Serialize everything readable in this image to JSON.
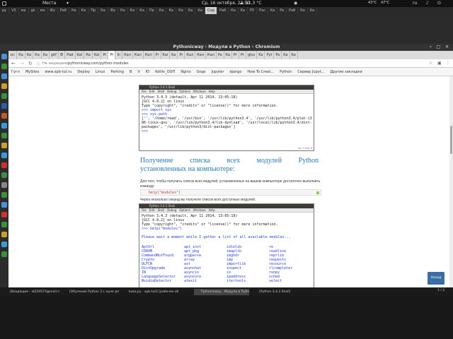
{
  "topbar": {
    "menu": "Места",
    "datetime": "Ср, 16 октября, 23:50",
    "weather": "11,3 °C",
    "stat1": "43°C",
    "stat2": "47°C",
    "language": "ru"
  },
  "desktop_tabs": [
    "ру",
    "VS",
    "ма",
    "gk",
    "ма",
    "Фу",
    "Раб",
    "Ка",
    "Ка",
    "Пр",
    "Ка",
    "Фу",
    "Ка",
    "Ка",
    "Ка",
    "Пр",
    "Ка",
    "Ка",
    "Ка",
    "Ка",
    "Ка",
    "Сод",
    "Раб",
    "Ка",
    "Ka",
    "РУ",
    "Рас",
    "Ka",
    "Pa",
    "Раб",
    "Ка",
    "Ka"
  ],
  "window": {
    "title": "Pythonicway - Модули в Python – Chromium"
  },
  "browser": {
    "tabs": [
      "vs:",
      "Ка",
      "Ka",
      "Ка",
      "Ka",
      "gkf",
      "Ф",
      "Рай",
      "Kal",
      "Ка",
      "Kal",
      "Pr",
      "Pr",
      "In",
      "Кал",
      "Кал",
      "Кал",
      "Pr",
      "Kal",
      "Ka",
      "Pr",
      "Кал",
      "Кал",
      "Кал",
      "Pa",
      "Ka",
      "Pr",
      "Pr",
      "glos",
      "Ka",
      "Pyt",
      "Pa",
      "Ka",
      "Ka"
    ],
    "address": {
      "security": "Не защищено",
      "url": "pythonicway.com/python-modules"
    },
    "bookmarks": [
      "Гугл",
      "MySites",
      "www.spb-tut.ru",
      "Deploy",
      "Linux",
      "Parking",
      "B",
      "V",
      "Ю",
      "Kotlin_OOП",
      "Nginx",
      "Gogs",
      "Jupyter",
      "django",
      "How To Creat...",
      "Python",
      "Сервер Jupyt...",
      "Другие закладки"
    ]
  },
  "terminal1": {
    "title": "Python 3.4.3 Shell",
    "menu": [
      "File",
      "Edit",
      "Shell",
      "Debug",
      "Options",
      "Windows",
      "Help"
    ],
    "lines": [
      {
        "t": "Python 3.4.3 (default, Apr 11 2014, 13:05:18)",
        "c": ""
      },
      {
        "t": "[GCC 4.8.2] on linux",
        "c": ""
      },
      {
        "t": "Type \"copyright\", \"credits\" or \"license()\" for more information.",
        "c": ""
      },
      {
        "t": ">>> import sys",
        "c": "blue"
      },
      {
        "t": ">>> sys.path",
        "c": "blue"
      },
      {
        "t": "['', '/home/read', '/usr/bin', '/usr/lib/python3.4', '/usr/lib/python3.4/plat-i3",
        "c": ""
      },
      {
        "t": "86-linux-gnu', '/usr/lib/python3.4/lib-dynload', '/usr/local/lib/python3.4/dist-",
        "c": ""
      },
      {
        "t": "packages', '/usr/lib/python3/dist-packages']",
        "c": ""
      },
      {
        "t": ">>>",
        "c": "blue"
      }
    ],
    "status": "Ln: 7 Col: 4"
  },
  "section": {
    "heading_line1": "Получение списка всех модулей Python",
    "heading_line2": "установленных на компьютере:",
    "paragraph1": "Для того, чтобы получить список всех модулей, установленных на вашем компьютере достаточно выполнить команду:",
    "code": "help(\"modules\")",
    "paragraph2": "Через несколько секунд вы получите список всех доступных модулей."
  },
  "terminal2": {
    "title": "Python 3.4.3 Shell",
    "menu": [
      "File",
      "Edit",
      "Shell",
      "Debug",
      "Options",
      "Windows",
      "Help"
    ],
    "header_lines": [
      {
        "t": "Python 3.4.3 (default, Apr 11 2014, 13:05:18)",
        "c": ""
      },
      {
        "t": "[GCC 4.8.2] on linux",
        "c": ""
      },
      {
        "t": "Type \"copyright\", \"credits\" or \"license()\" for more information.",
        "c": ""
      },
      {
        "t": ">>> help(\"modules\")",
        "c": "blue"
      },
      {
        "t": "",
        "c": ""
      },
      {
        "t": "Please wait a moment while I gather a list of all available modules...",
        "c": "blue"
      },
      {
        "t": "",
        "c": ""
      }
    ],
    "modules": [
      [
        "AptUrl",
        "apt_inst",
        "idlelib",
        "re"
      ],
      [
        "CDROM",
        "apt_pkg",
        "imaplib",
        "readline"
      ],
      [
        "CommandNotFound",
        "argparse",
        "imghdr",
        "reprlib"
      ],
      [
        "Crypto",
        "array",
        "imp",
        "requests"
      ],
      [
        "DLFCN",
        "ast",
        "importlib",
        "resource"
      ],
      [
        "DistUpgrade",
        "asynchat",
        "inspect",
        "rlcompleter"
      ],
      [
        "IN",
        "asyncio",
        "io",
        "runpy"
      ],
      [
        "LanguageSelector",
        "asyncore",
        "ipaddress",
        "sched"
      ],
      [
        "NvidiaDetector",
        "atexit",
        "itertools",
        "select"
      ]
    ]
  },
  "next_button": "Назад",
  "page_indicator": "1 / 2",
  "taskbar": [
    "[Входящие - id250573@mail.ru]",
    "[Обучение Python 3 с нуля для пр...",
    "kuka.py - spb-tut2 [рабочее области...",
    "Pythonicway - Модули в Python –...",
    "[Python 3.4.3 Shell]"
  ],
  "colors": {
    "heading": "#2477b5",
    "terminal_title_bg": "#3c3b37",
    "next_button": "#3b6ea5"
  }
}
